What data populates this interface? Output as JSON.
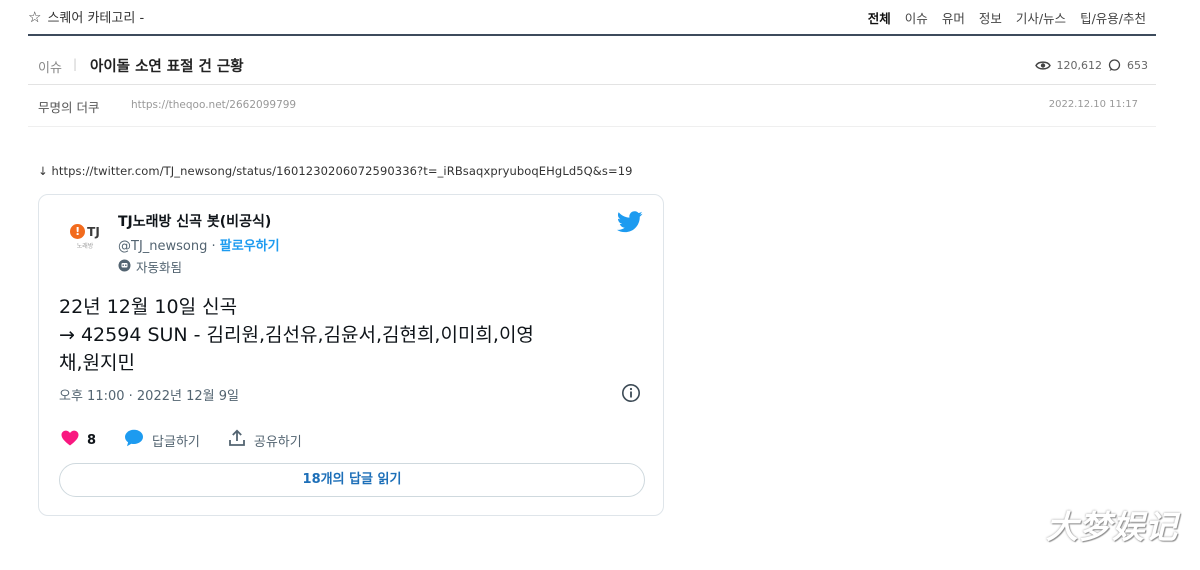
{
  "topbar": {
    "category_label": "스퀘어 카테고리 -",
    "tabs": [
      {
        "label": "전체",
        "active": true
      },
      {
        "label": "이슈"
      },
      {
        "label": "유머"
      },
      {
        "label": "정보"
      },
      {
        "label": "기사/뉴스"
      },
      {
        "label": "팁/유용/추천"
      }
    ]
  },
  "post": {
    "category": "이슈",
    "separator": "|",
    "title": "아이돌 소연 표절 건 근황",
    "views": "120,612",
    "comments": "653",
    "author": "무명의 더쿠",
    "link": "https://theqoo.net/2662099799",
    "date": "2022.12.10 11:17",
    "tweet_url": "↓ https://twitter.com/TJ_newsong/status/1601230206072590336?t=_iRBsaqxpryuboqEHgLd5Q&s=19"
  },
  "tweet": {
    "avatar_logo": "!",
    "avatar_text": "TJ",
    "avatar_sub": "노래방",
    "name": "TJ노래방 신곡 봇(비공식)",
    "handle": "@TJ_newsong",
    "dot": " · ",
    "follow": "팔로우하기",
    "bot_label": "자동화됨",
    "body_line1": "22년 12월 10일 신곡",
    "body_line2": "→ 42594 SUN - 김리원,김선유,김윤서,김현희,이미희,이영",
    "body_line3": "채,원지민",
    "time": "오후 11:00 · 2022년 12월 9일",
    "likes": "8",
    "reply_label": "답글하기",
    "share_label": "공유하기",
    "read_replies": "18개의 답글 읽기"
  },
  "watermark": "大梦娱记",
  "colors": {
    "twitter_blue": "#1d9bf0",
    "like_red": "#f91880",
    "header_line": "#3d4b5c"
  }
}
